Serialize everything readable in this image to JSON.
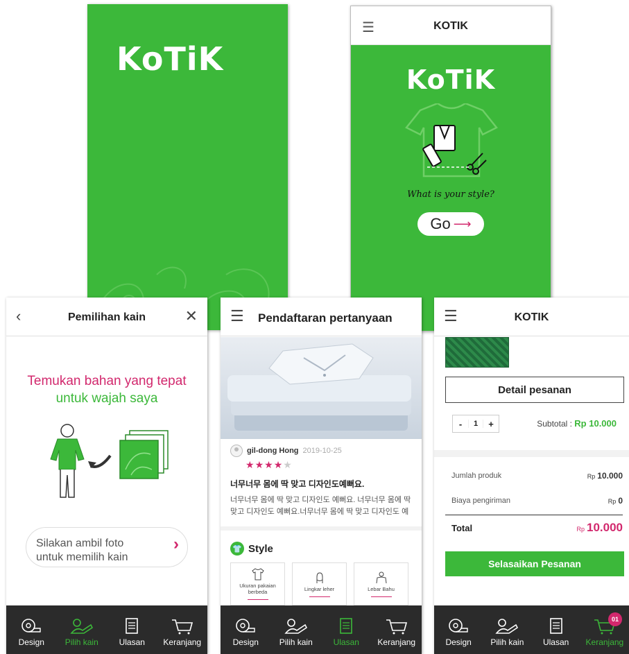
{
  "colors": {
    "brand_green": "#3cb83a",
    "accent_pink": "#d2286d",
    "nav_dark": "#2b2b2b"
  },
  "splash": {
    "logo": "KoTiK"
  },
  "home": {
    "header_title": "KOTIK",
    "logo": "KoTiK",
    "tagline": "What is your style?",
    "go_label": "Go"
  },
  "fabric": {
    "title": "Pemilihan kain",
    "headline_line1": "Temukan bahan yang tepat",
    "headline_line2": "untuk wajah saya",
    "photo_button": "Silakan ambil foto untuk memilih kain"
  },
  "review": {
    "title": "Pendaftaran pertanyaan",
    "author": "gil-dong Hong",
    "date": "2019-10-25",
    "rating": 4,
    "rating_max": 5,
    "review_title": "너무너무 몸에 딱 맞고 디자인도예뻐요.",
    "review_body": "너무너무 몸에 딱 맞고 디자인도 예뻐요. 너무너무 몸에 딱 맞고 디자인도 예뻐요.너무너무 몸에 딱 맞고 디자인도 예뻐 …",
    "style_heading": "Style",
    "style_cards": [
      {
        "label": "Ukuran pakaian berbeda"
      },
      {
        "label": "Lingkar leher"
      },
      {
        "label": "Lebar Bahu"
      }
    ]
  },
  "cart": {
    "header_title": "KOTIK",
    "detail_button": "Detail pesanan",
    "qty_minus": "-",
    "qty_value": "1",
    "qty_plus": "+",
    "subtotal_label": "Subtotal :",
    "subtotal_value": "Rp 10.000",
    "rows": [
      {
        "label": "Jumlah produk",
        "currency": "Rp",
        "amount": "10.000"
      },
      {
        "label": "Biaya pengiriman",
        "currency": "Rp",
        "amount": "0"
      }
    ],
    "total_label": "Total",
    "total_currency": "Rp",
    "total_amount": "10.000",
    "finish_button": "Selasaikan Pesanan"
  },
  "nav": {
    "design": "Design",
    "pilih_kain": "Pilih kain",
    "ulasan": "Ulasan",
    "keranjang": "Keranjang",
    "cart_badge": "01"
  }
}
